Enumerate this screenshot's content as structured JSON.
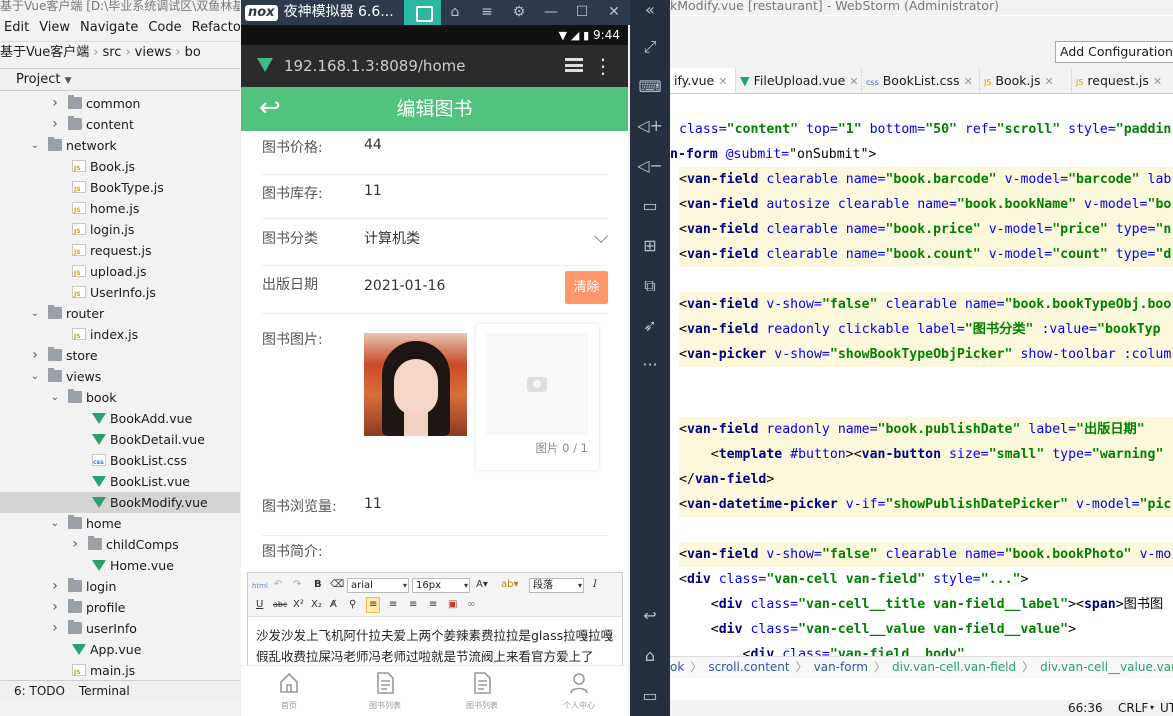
{
  "ide": {
    "title_left": "基于Vue客户端 [D:\\毕业系统调试区\\双鱼林基于",
    "title_right": "kModify.vue [restaurant] - WebStorm (Administrator)",
    "menu": [
      "Edit",
      "View",
      "Navigate",
      "Code",
      "Refactor"
    ],
    "breadcrumb": [
      "基于Vue客户端",
      "src",
      "views",
      "bo"
    ],
    "project_label": "Project",
    "tree": [
      {
        "label": "common",
        "indent": 1,
        "arrow": "›",
        "type": "folder"
      },
      {
        "label": "content",
        "indent": 1,
        "arrow": "›",
        "type": "folder"
      },
      {
        "label": "network",
        "indent": 0,
        "arrow": "⌄",
        "type": "folder"
      },
      {
        "label": "Book.js",
        "indent": 2,
        "arrow": "",
        "type": "js"
      },
      {
        "label": "BookType.js",
        "indent": 2,
        "arrow": "",
        "type": "js"
      },
      {
        "label": "home.js",
        "indent": 2,
        "arrow": "",
        "type": "js"
      },
      {
        "label": "login.js",
        "indent": 2,
        "arrow": "",
        "type": "js"
      },
      {
        "label": "request.js",
        "indent": 2,
        "arrow": "",
        "type": "js"
      },
      {
        "label": "upload.js",
        "indent": 2,
        "arrow": "",
        "type": "js"
      },
      {
        "label": "UserInfo.js",
        "indent": 2,
        "arrow": "",
        "type": "js"
      },
      {
        "label": "router",
        "indent": 0,
        "arrow": "⌄",
        "type": "folder"
      },
      {
        "label": "index.js",
        "indent": 2,
        "arrow": "",
        "type": "js"
      },
      {
        "label": "store",
        "indent": 0,
        "arrow": "›",
        "type": "folder"
      },
      {
        "label": "views",
        "indent": 0,
        "arrow": "⌄",
        "type": "folder"
      },
      {
        "label": "book",
        "indent": 1,
        "arrow": "⌄",
        "type": "folder"
      },
      {
        "label": "BookAdd.vue",
        "indent": 3,
        "arrow": "",
        "type": "vue"
      },
      {
        "label": "BookDetail.vue",
        "indent": 3,
        "arrow": "",
        "type": "vue"
      },
      {
        "label": "BookList.css",
        "indent": 3,
        "arrow": "",
        "type": "css"
      },
      {
        "label": "BookList.vue",
        "indent": 3,
        "arrow": "",
        "type": "vue"
      },
      {
        "label": "BookModify.vue",
        "indent": 3,
        "arrow": "",
        "type": "vue",
        "selected": true
      },
      {
        "label": "home",
        "indent": 1,
        "arrow": "⌄",
        "type": "folder"
      },
      {
        "label": "childComps",
        "indent": 2,
        "arrow": "›",
        "type": "folder"
      },
      {
        "label": "Home.vue",
        "indent": 3,
        "arrow": "",
        "type": "vue"
      },
      {
        "label": "login",
        "indent": 1,
        "arrow": "›",
        "type": "folder"
      },
      {
        "label": "profile",
        "indent": 1,
        "arrow": "›",
        "type": "folder"
      },
      {
        "label": "userInfo",
        "indent": 1,
        "arrow": "›",
        "type": "folder"
      },
      {
        "label": "App.vue",
        "indent": 2,
        "arrow": "",
        "type": "vue"
      },
      {
        "label": "main.js",
        "indent": 2,
        "arrow": "",
        "type": "js"
      }
    ],
    "bottom_tabs": [
      "6: TODO",
      "Terminal"
    ],
    "add_configuration": "Add Configuration...",
    "editor_tabs": [
      "ify.vue",
      "FileUpload.vue",
      "BookList.css",
      "Book.js",
      "request.js"
    ],
    "code_crumbs": [
      "ok",
      "scroll.content",
      "van-form",
      "div.van-cell.van-field",
      "div.van-cell__value.van-fie"
    ],
    "status": {
      "position": "66:36",
      "line_ending": "CRLF",
      "encoding": "UT"
    }
  },
  "emulator": {
    "logo": "nox",
    "title": "夜神模拟器 6.6...",
    "time": "9:44",
    "url": "192.168.1.3:8089/home"
  },
  "app": {
    "nav_title": "编辑图书",
    "fields": {
      "price_label": "图书价格:",
      "price_value": "44",
      "stock_label": "图书库存:",
      "stock_value": "11",
      "category_label": "图书分类",
      "category_value": "计算机类",
      "date_label": "出版日期",
      "date_value": "2021-01-16",
      "clear_button": "清除",
      "photo_label": "图书图片:",
      "upload_count": "图片 0 / 1",
      "views_label": "图书浏览量:",
      "views_value": "11",
      "intro_label": "图书简介:"
    },
    "editor": {
      "font": "arial",
      "size": "16px",
      "paragraph": "段落",
      "content": "沙发沙发上飞机阿什拉夫爱上两个姜辣素费拉拉是glass拉嘎拉嘎假乱收费拉屎冯老师冯老师过啦就是节流阀上来看官方爱上了"
    },
    "tabbar": [
      "首页",
      "图书列表",
      "图书列表",
      "个人中心"
    ]
  }
}
